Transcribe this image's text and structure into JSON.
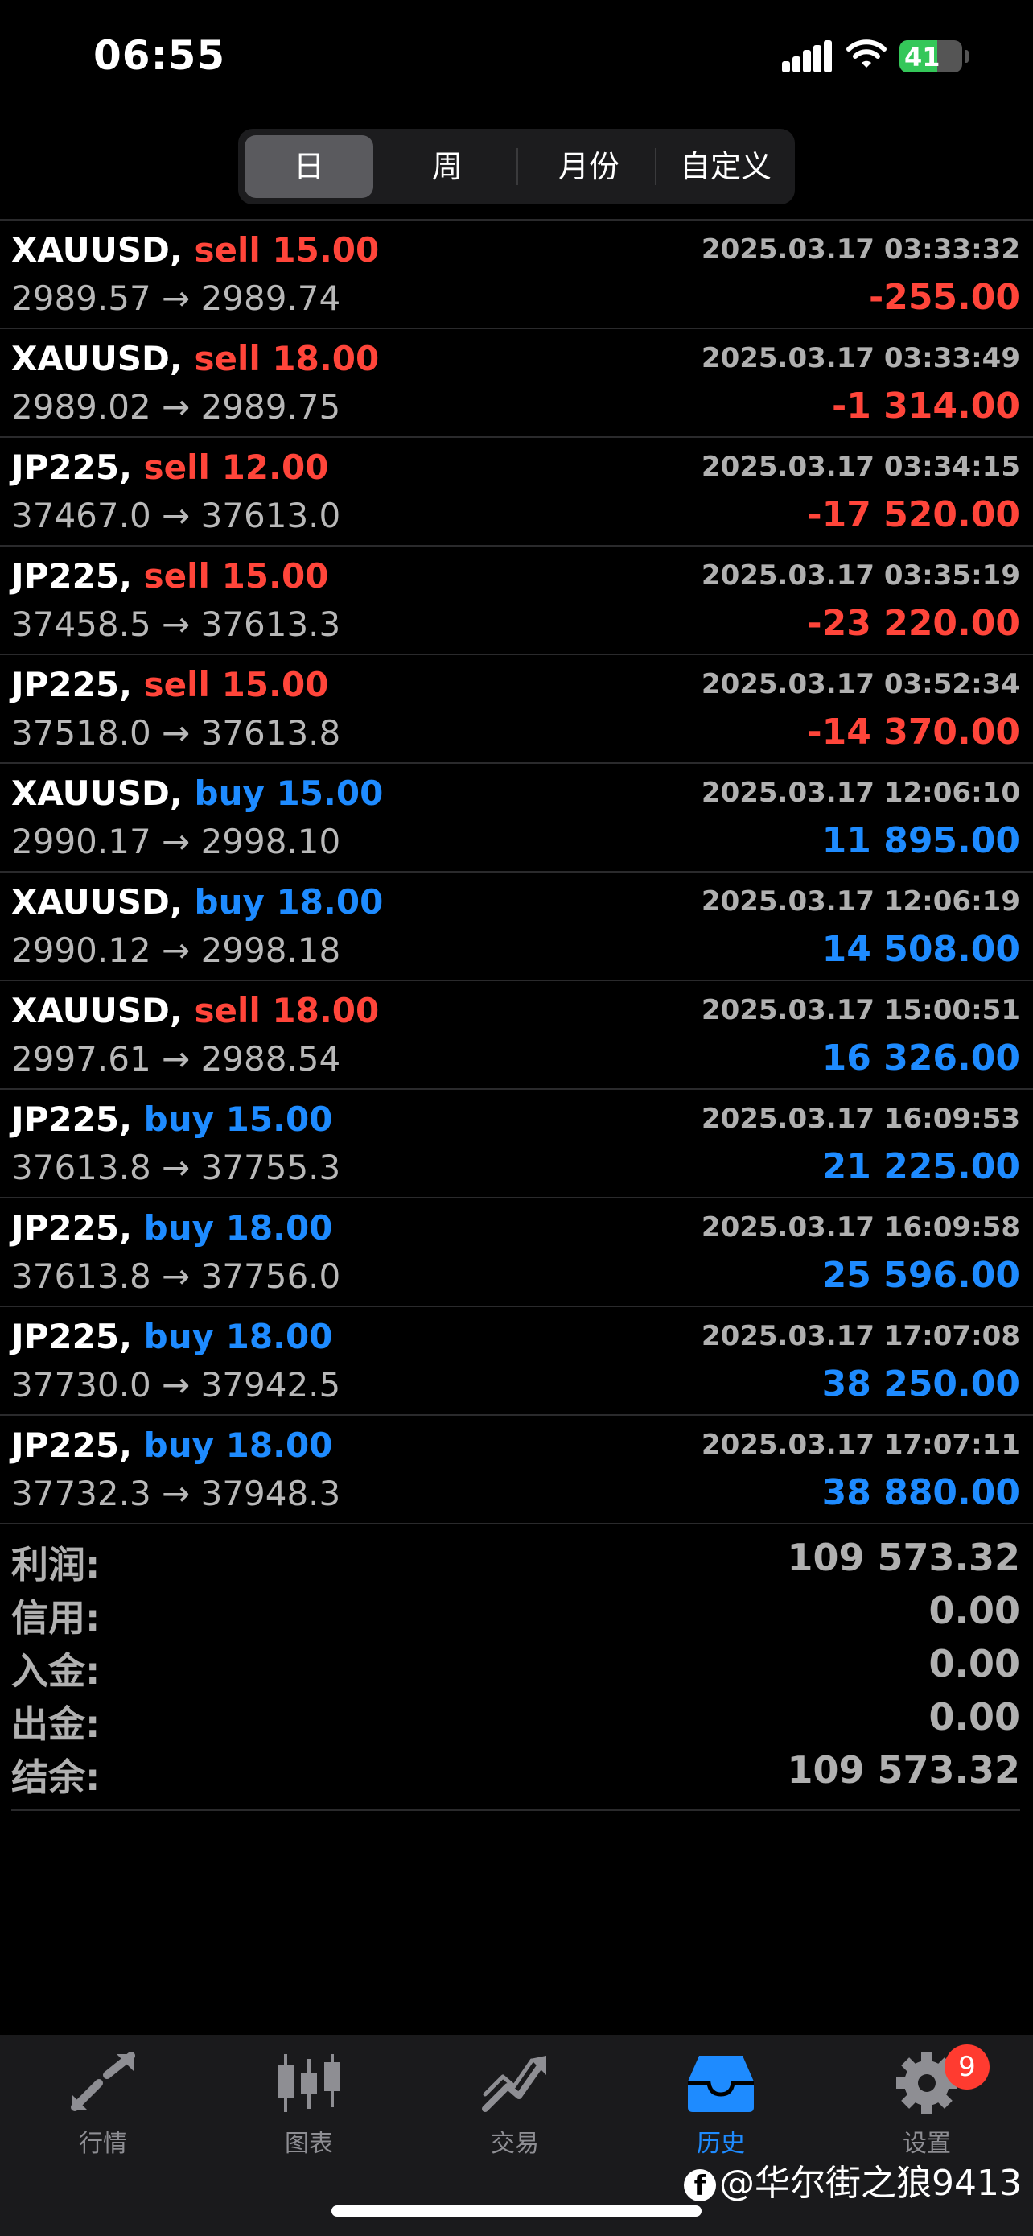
{
  "status": {
    "time": "06:55",
    "battery": "41"
  },
  "segment": {
    "tabs": [
      "日",
      "周",
      "月份",
      "自定义"
    ],
    "active": 0
  },
  "trades": [
    {
      "symbol": "XAUUSD,",
      "side": "sell 15.00",
      "dir": "sell",
      "datetime": "2025.03.17 03:33:32",
      "prices": "2989.57 → 2989.74",
      "profit": "-255.00"
    },
    {
      "symbol": "XAUUSD,",
      "side": "sell 18.00",
      "dir": "sell",
      "datetime": "2025.03.17 03:33:49",
      "prices": "2989.02 → 2989.75",
      "profit": "-1 314.00"
    },
    {
      "symbol": "JP225,",
      "side": "sell 12.00",
      "dir": "sell",
      "datetime": "2025.03.17 03:34:15",
      "prices": "37467.0 → 37613.0",
      "profit": "-17 520.00"
    },
    {
      "symbol": "JP225,",
      "side": "sell 15.00",
      "dir": "sell",
      "datetime": "2025.03.17 03:35:19",
      "prices": "37458.5 → 37613.3",
      "profit": "-23 220.00"
    },
    {
      "symbol": "JP225,",
      "side": "sell 15.00",
      "dir": "sell",
      "datetime": "2025.03.17 03:52:34",
      "prices": "37518.0 → 37613.8",
      "profit": "-14 370.00"
    },
    {
      "symbol": "XAUUSD,",
      "side": "buy 15.00",
      "dir": "buy",
      "datetime": "2025.03.17 12:06:10",
      "prices": "2990.17 → 2998.10",
      "profit": "11 895.00"
    },
    {
      "symbol": "XAUUSD,",
      "side": "buy 18.00",
      "dir": "buy",
      "datetime": "2025.03.17 12:06:19",
      "prices": "2990.12 → 2998.18",
      "profit": "14 508.00"
    },
    {
      "symbol": "XAUUSD,",
      "side": "sell 18.00",
      "dir": "sell",
      "datetime": "2025.03.17 15:00:51",
      "prices": "2997.61 → 2988.54",
      "profit": "16 326.00"
    },
    {
      "symbol": "JP225,",
      "side": "buy 15.00",
      "dir": "buy",
      "datetime": "2025.03.17 16:09:53",
      "prices": "37613.8 → 37755.3",
      "profit": "21 225.00"
    },
    {
      "symbol": "JP225,",
      "side": "buy 18.00",
      "dir": "buy",
      "datetime": "2025.03.17 16:09:58",
      "prices": "37613.8 → 37756.0",
      "profit": "25 596.00"
    },
    {
      "symbol": "JP225,",
      "side": "buy 18.00",
      "dir": "buy",
      "datetime": "2025.03.17 17:07:08",
      "prices": "37730.0 → 37942.5",
      "profit": "38 250.00"
    },
    {
      "symbol": "JP225,",
      "side": "buy 18.00",
      "dir": "buy",
      "datetime": "2025.03.17 17:07:11",
      "prices": "37732.3 → 37948.3",
      "profit": "38 880.00"
    }
  ],
  "summary": [
    {
      "label": "利润:",
      "value": "109 573.32"
    },
    {
      "label": "信用:",
      "value": "0.00"
    },
    {
      "label": "入金:",
      "value": "0.00"
    },
    {
      "label": "出金:",
      "value": "0.00"
    },
    {
      "label": "结余:",
      "value": "109 573.32"
    }
  ],
  "tabbar": {
    "items": [
      {
        "label": "行情",
        "icon": "quotes-arrows-icon"
      },
      {
        "label": "图表",
        "icon": "candlestick-chart-icon"
      },
      {
        "label": "交易",
        "icon": "trade-trend-icon"
      },
      {
        "label": "历史",
        "icon": "history-inbox-icon"
      },
      {
        "label": "设置",
        "icon": "gear-icon"
      }
    ],
    "active": 3,
    "settings_badge": "9"
  },
  "watermark": {
    "fb_glyph": "f",
    "text": "@华尔街之狼9413"
  },
  "colors": {
    "sell": "#ff453a",
    "buy": "#1e8bff",
    "loss": "#ff453a",
    "profit": "#1e8bff",
    "active_tab": "#1e8bff"
  }
}
